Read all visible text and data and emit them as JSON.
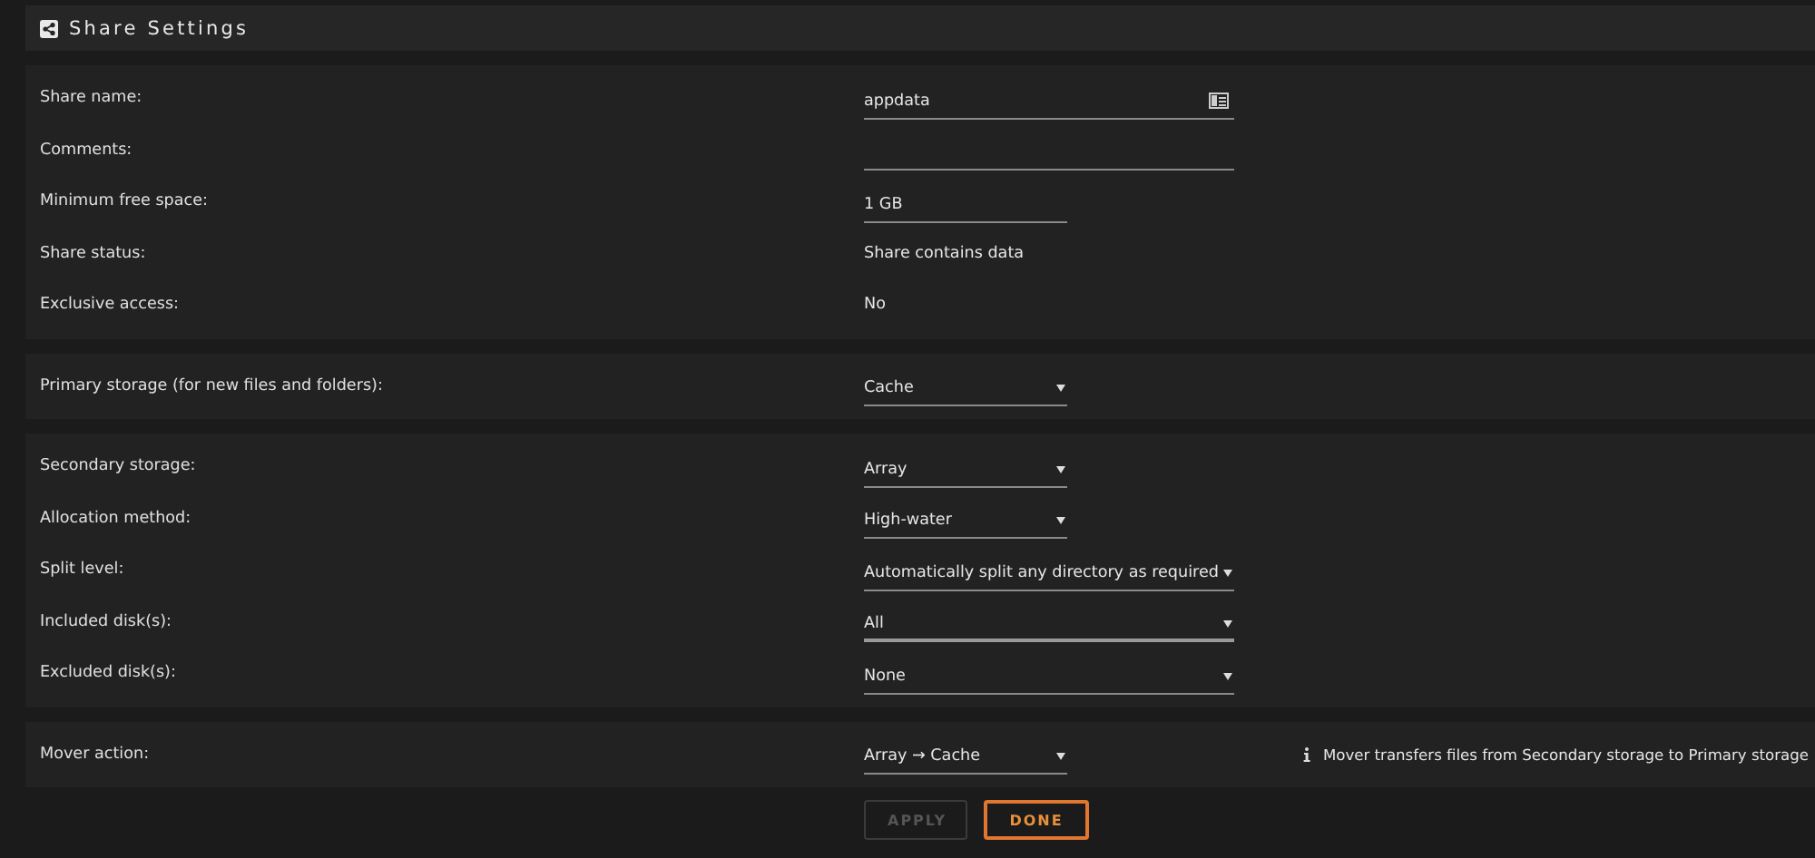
{
  "header": {
    "title": "Share Settings"
  },
  "sections": [
    {
      "rows": [
        {
          "label": "Share name:",
          "control": {
            "kind": "long-input",
            "value": "appdata",
            "picker": true
          }
        },
        {
          "label": "Comments:",
          "control": {
            "kind": "long-input"
          }
        },
        {
          "label": "Minimum free space:",
          "control": {
            "kind": "short-input",
            "value": "1 GB"
          }
        },
        {
          "label": "Share status:",
          "control": {
            "kind": "static",
            "value": "Share contains data"
          }
        },
        {
          "label": "Exclusive access:",
          "control": {
            "kind": "static",
            "value": "No"
          }
        }
      ]
    },
    {
      "rows": [
        {
          "label": "Primary storage (for new files and folders):",
          "control": {
            "kind": "short-select",
            "value": "Cache"
          }
        }
      ]
    },
    {
      "rows": [
        {
          "label": "Secondary storage:",
          "control": {
            "kind": "short-select",
            "value": "Array"
          }
        },
        {
          "label": "Allocation method:",
          "control": {
            "kind": "short-select",
            "value": "High-water"
          }
        },
        {
          "label": "Split level:",
          "control": {
            "kind": "long-select",
            "value": "Automatically split any directory as required"
          }
        },
        {
          "label": "Included disk(s):",
          "control": {
            "kind": "long-select",
            "value": "All",
            "focused": true
          }
        },
        {
          "label": "Excluded disk(s):",
          "control": {
            "kind": "long-select",
            "value": "None"
          }
        }
      ]
    },
    {
      "rows": [
        {
          "label": "Mover action:",
          "control": {
            "kind": "short-select",
            "value": "Array → Cache"
          },
          "note": "Mover transfers files from Secondary storage to Primary storage"
        }
      ]
    }
  ],
  "buttons": [
    {
      "label": "APPLY",
      "disabled": true
    },
    {
      "label": "DONE",
      "disabled": false
    }
  ]
}
